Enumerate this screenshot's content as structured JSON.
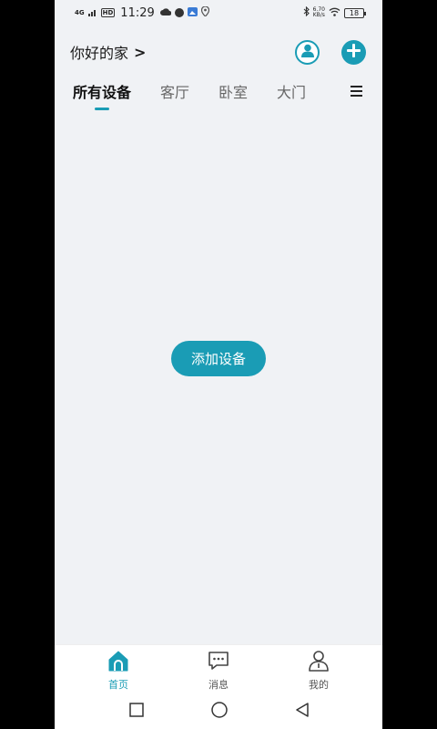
{
  "status_bar": {
    "network": "4G",
    "hd": "HD",
    "time": "11:29",
    "speed_value": "6.70",
    "speed_unit": "KB/s",
    "battery": "18"
  },
  "header": {
    "home_name": "你好的家",
    "chevron": ">"
  },
  "tabs": [
    {
      "label": "所有设备",
      "active": true
    },
    {
      "label": "客厅",
      "active": false
    },
    {
      "label": "卧室",
      "active": false
    },
    {
      "label": "大门",
      "active": false
    }
  ],
  "main": {
    "add_device_label": "添加设备"
  },
  "bottom_nav": [
    {
      "label": "首页",
      "icon": "home-icon",
      "active": true
    },
    {
      "label": "消息",
      "icon": "message-icon",
      "active": false
    },
    {
      "label": "我的",
      "icon": "profile-icon",
      "active": false
    }
  ],
  "colors": {
    "accent": "#1a9cb5",
    "background": "#f0f2f5"
  }
}
